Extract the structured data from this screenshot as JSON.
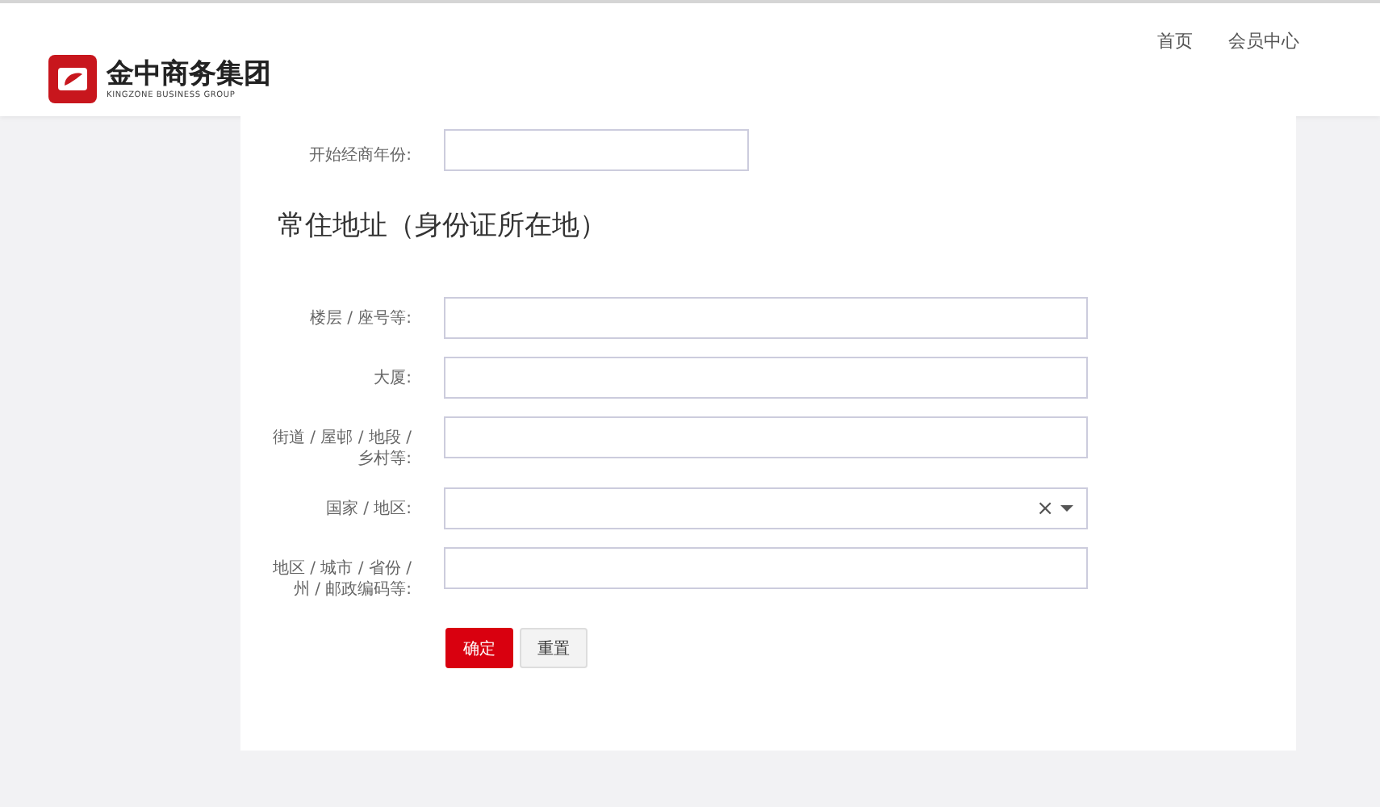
{
  "header": {
    "logo_text": "金中商务集团",
    "logo_subtext": "KINGZONE BUSINESS GROUP",
    "nav": [
      {
        "label": "首页"
      },
      {
        "label": "会员中心"
      }
    ]
  },
  "top_field": {
    "label": "开始经商年份:"
  },
  "section_title": "常住地址（身份证所在地）",
  "fields": [
    {
      "kind": "text",
      "label": "楼层 / 座号等:"
    },
    {
      "kind": "text",
      "label": "大厦:"
    },
    {
      "kind": "text",
      "label": "街道 / 屋邨 / 地段 / 乡村等:"
    },
    {
      "kind": "select",
      "label": "国家 / 地区:",
      "clear": "×"
    },
    {
      "kind": "text",
      "label": "地区 / 城市 / 省份 / 州 / 邮政编码等:"
    }
  ],
  "buttons": [
    {
      "label": "确定",
      "kind": "primary"
    },
    {
      "label": "重置",
      "kind": "default"
    }
  ]
}
